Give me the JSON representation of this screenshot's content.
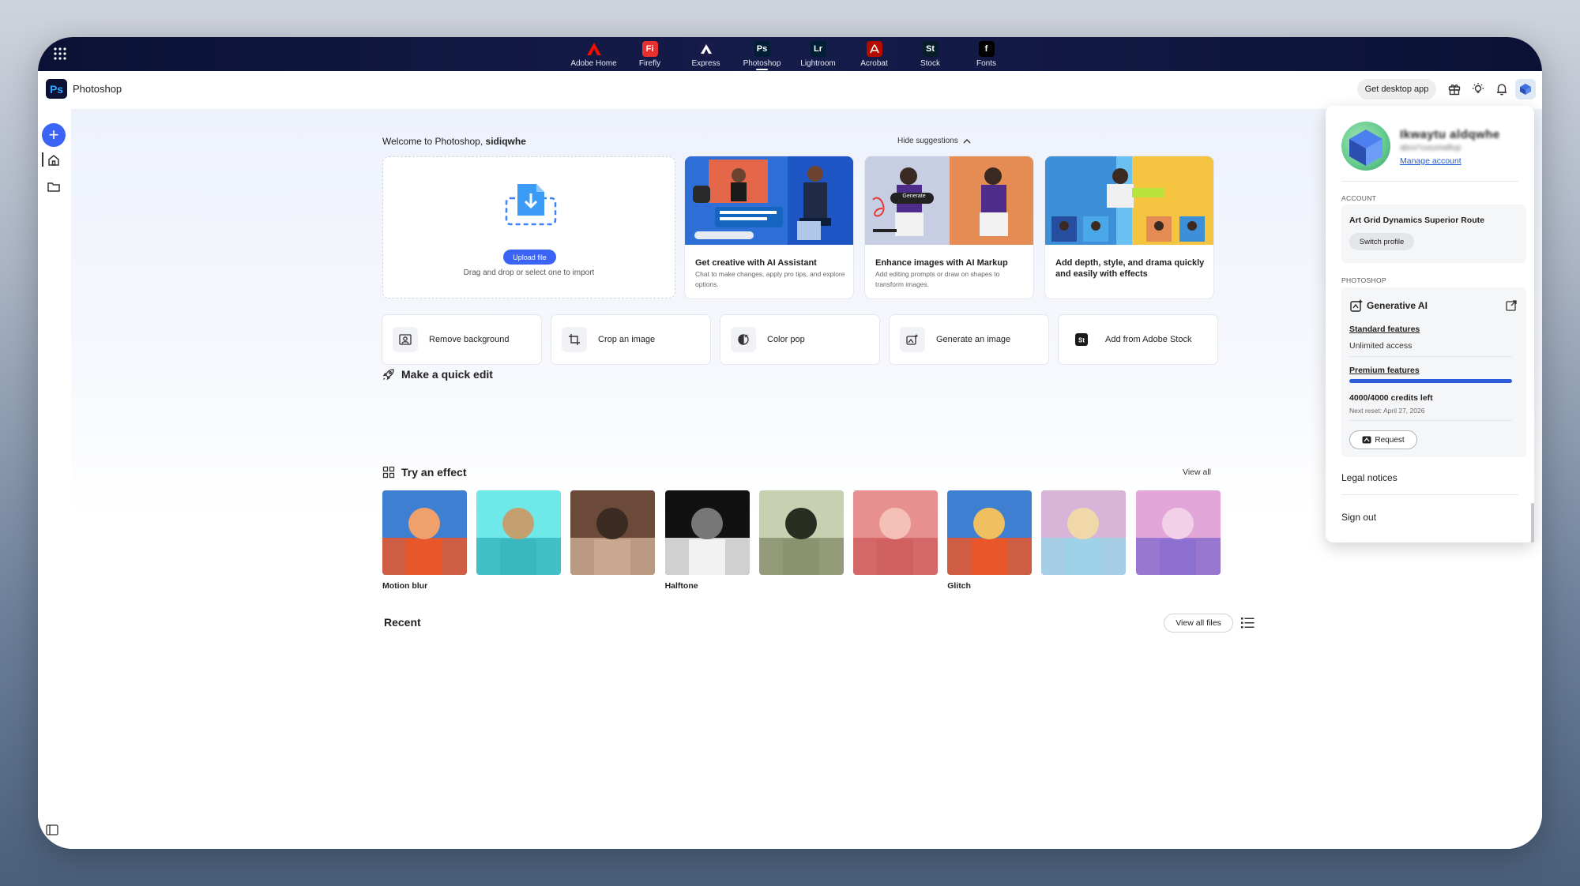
{
  "appbar": {
    "apps": [
      {
        "label": "Adobe Home",
        "glyph": "",
        "color": "#eb1000",
        "icon": "adobe-home-icon"
      },
      {
        "label": "Firefly",
        "glyph": "Fi",
        "color": "#e8302e",
        "icon": "firefly-icon"
      },
      {
        "label": "Express",
        "glyph": "",
        "color": "#1b1b4a",
        "icon": "express-icon"
      },
      {
        "label": "Photoshop",
        "glyph": "Ps",
        "color": "#001e36",
        "icon": "photoshop-icon"
      },
      {
        "label": "Lightroom",
        "glyph": "Lr",
        "color": "#001e36",
        "icon": "lightroom-icon"
      },
      {
        "label": "Acrobat",
        "glyph": "",
        "color": "#b30b00",
        "icon": "acrobat-icon"
      },
      {
        "label": "Stock",
        "glyph": "St",
        "color": "#061e29",
        "icon": "stock-icon"
      },
      {
        "label": "Fonts",
        "glyph": "f",
        "color": "#000000",
        "icon": "fonts-icon"
      }
    ],
    "active": "Photoshop"
  },
  "header": {
    "logo": "Ps",
    "app_name": "Photoshop",
    "desktop_button": "Get desktop app"
  },
  "main": {
    "welcome_prefix": "Welcome to Photoshop, ",
    "welcome_user": "sidiqwhe",
    "hide_suggestions": "Hide suggestions",
    "upload": {
      "button": "Upload file",
      "hint": "Drag and drop or select one to import"
    },
    "suggestions": [
      {
        "title": "Get creative with AI Assistant",
        "desc": "Chat to make changes, apply pro tips, and explore options."
      },
      {
        "title": "Enhance images with AI Markup",
        "desc": "Add editing prompts or draw on shapes to transform images.",
        "badge": "Generate"
      },
      {
        "title": "Add depth, style, and drama quickly and easily with effects",
        "desc": ""
      }
    ],
    "quick_edit_title": "Make a quick edit",
    "quick_edits": [
      {
        "label": "Remove background",
        "icon": "remove-background-icon"
      },
      {
        "label": "Crop an image",
        "icon": "crop-icon"
      },
      {
        "label": "Color pop",
        "icon": "color-pop-icon"
      },
      {
        "label": "Generate an image",
        "icon": "generate-image-icon"
      },
      {
        "label": "Add from Adobe Stock",
        "icon": "adobe-stock-icon",
        "glyph": "St"
      }
    ],
    "effects_title": "Try an effect",
    "view_all": "View all",
    "effects": [
      {
        "label": "Motion blur",
        "colors": [
          "#3f7fd1",
          "#e8572a",
          "#f0a06a"
        ]
      },
      {
        "label": "",
        "colors": [
          "#6ee8e8",
          "#3ab8c0",
          "#c4a070"
        ]
      },
      {
        "label": "",
        "colors": [
          "#6b4a3a",
          "#c8a890",
          "#3b2a22"
        ]
      },
      {
        "label": "Halftone",
        "colors": [
          "#111111",
          "#f2f2f2",
          "#777777"
        ]
      },
      {
        "label": "",
        "colors": [
          "#c7d0b0",
          "#8a9270",
          "#2a2e22"
        ]
      },
      {
        "label": "",
        "colors": [
          "#e89090",
          "#d06060",
          "#f4c0b8"
        ]
      },
      {
        "label": "Glitch",
        "colors": [
          "#3f7fd1",
          "#e8572a",
          "#f0c060"
        ]
      },
      {
        "label": "",
        "colors": [
          "#d7b4d8",
          "#9ed2e8",
          "#f0d8a8"
        ]
      },
      {
        "label": "",
        "colors": [
          "#e2a7d8",
          "#8c6fd0",
          "#f2d0e8"
        ]
      }
    ],
    "recent_title": "Recent",
    "view_all_files": "View all files"
  },
  "account": {
    "name": "Ikwaytu aldqwhe",
    "email": "abco*cusumaftup",
    "manage": "Manage account",
    "account_section": "ACCOUNT",
    "account_name": "Art Grid Dynamics Superior Route",
    "switch_profile": "Switch profile",
    "photoshop_section": "PHOTOSHOP",
    "genai_title": "Generative AI",
    "standard_features": "Standard features",
    "standard_value": "Unlimited access",
    "premium_features": "Premium features",
    "credits_fraction": 1.0,
    "credits": "4000/4000 credits left",
    "next_reset": "Next reset: April 27, 2026",
    "request": "Request",
    "legal": "Legal notices",
    "sign_out": "Sign out"
  },
  "colors": {
    "accent": "#3b63f5",
    "credits_bar": "#2c5ed9",
    "appbar": "#0b1235"
  }
}
